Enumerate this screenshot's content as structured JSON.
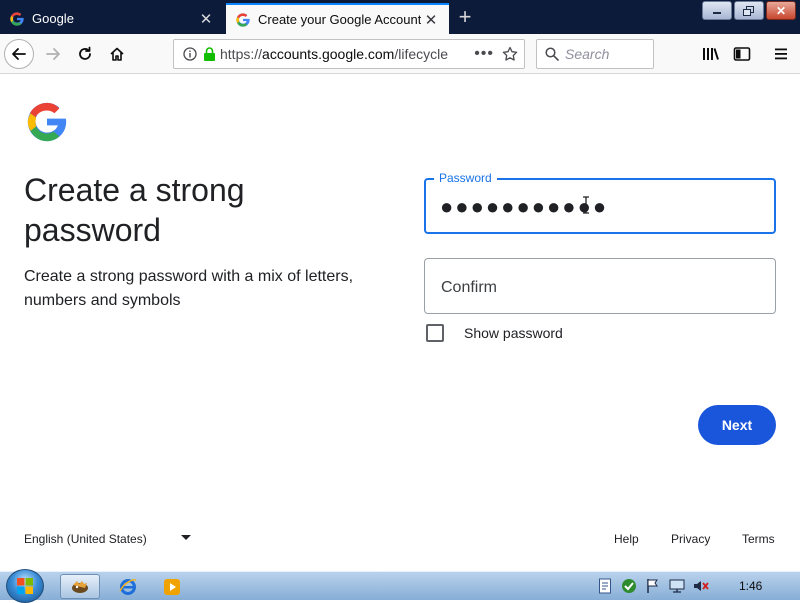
{
  "browser": {
    "tabs": [
      {
        "title": "Google",
        "favicon": "google-g-icon",
        "active": false
      },
      {
        "title": "Create your Google Account",
        "favicon": "google-g-icon",
        "active": true
      }
    ],
    "url": {
      "prefix": "https://",
      "host": "accounts.google.com",
      "rest": "/lifecycle"
    },
    "search_placeholder": "Search"
  },
  "page": {
    "heading": "Create a strong password",
    "subtext": "Create a strong password with a mix of letters, numbers and symbols",
    "password": {
      "label": "Password",
      "value": "●●●●●●●●●●●"
    },
    "confirm": {
      "placeholder": "Confirm"
    },
    "show_password_label": "Show password",
    "next_label": "Next"
  },
  "footer": {
    "language": "English (United States)",
    "links": [
      "Help",
      "Privacy",
      "Terms"
    ]
  },
  "taskbar": {
    "clock": "1:46"
  },
  "colors": {
    "accent": "#1a73e8",
    "next_button": "#1a56db",
    "tab_strip": "#0c1b3a"
  }
}
